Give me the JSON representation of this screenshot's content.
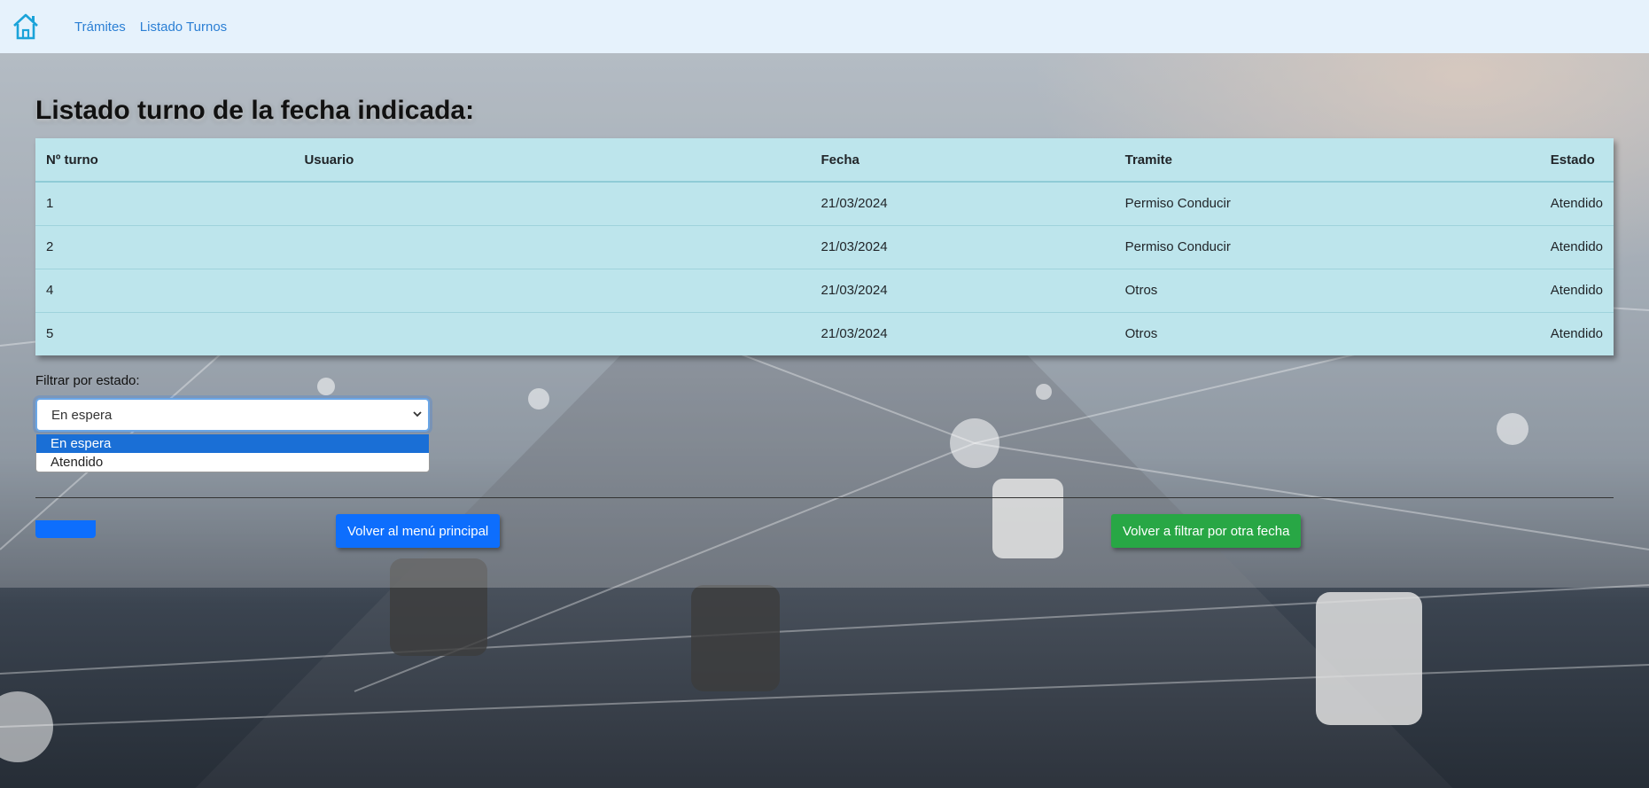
{
  "navbar": {
    "home_icon": "home-icon",
    "links": [
      "Trámites",
      "Listado Turnos"
    ]
  },
  "page": {
    "title": "Listado turno de la fecha indicada:"
  },
  "table": {
    "headers": [
      "Nº turno",
      "Usuario",
      "Fecha",
      "Tramite",
      "Estado"
    ],
    "rows": [
      [
        "1",
        "",
        "21/03/2024",
        "Permiso Conducir",
        "Atendido"
      ],
      [
        "2",
        "",
        "21/03/2024",
        "Permiso Conducir",
        "Atendido"
      ],
      [
        "4",
        "",
        "21/03/2024",
        "Otros",
        "Atendido"
      ],
      [
        "5",
        "",
        "21/03/2024",
        "Otros",
        "Atendido"
      ]
    ]
  },
  "filter": {
    "label": "Filtrar por estado:",
    "selected": "En espera",
    "options": [
      "En espera",
      "Atendido"
    ],
    "caret_icon": "chevron-down-icon"
  },
  "buttons": {
    "back_main": "Volver al menú principal",
    "refilter": "Volver a filtrar por otra fecha"
  },
  "colors": {
    "navbar_bg": "#e6f2fc",
    "link": "#2b7fd4",
    "table_bg": "#bde5ec",
    "primary": "#0d6efd",
    "success": "#28a745"
  }
}
